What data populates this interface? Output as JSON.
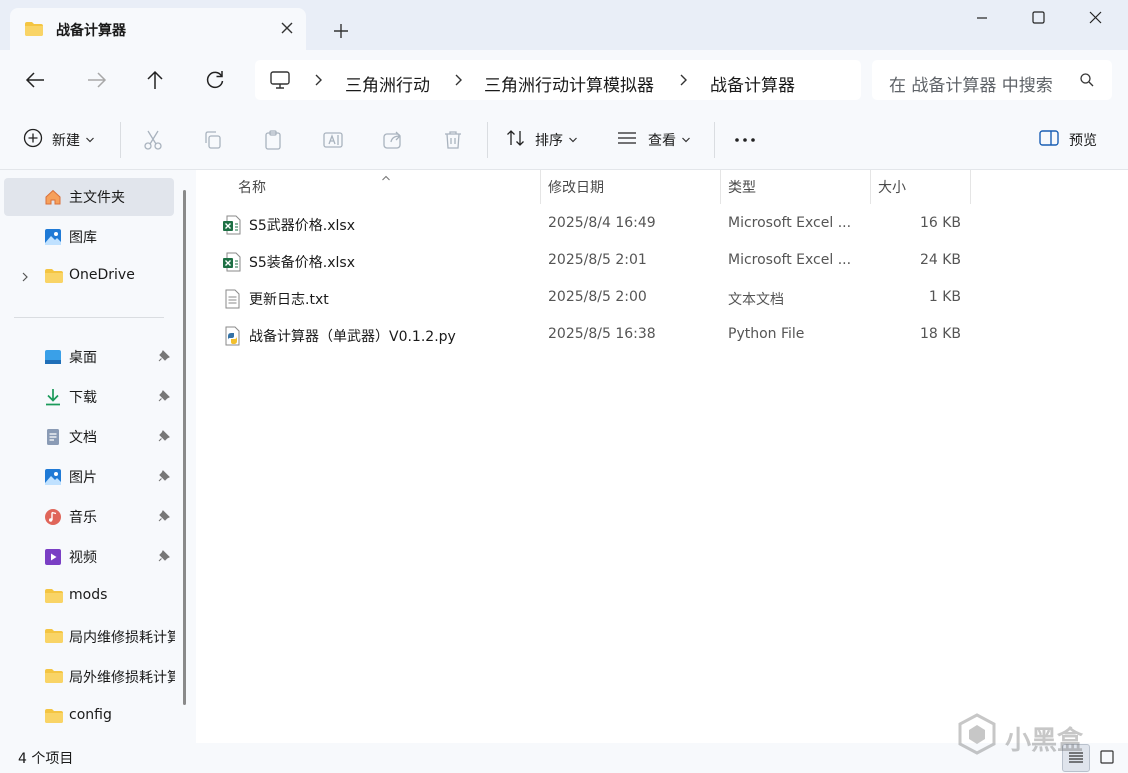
{
  "window": {
    "tab_title": "战备计算器"
  },
  "address": {
    "crumbs": [
      "三角洲行动",
      "三角洲行动计算模拟器",
      "战备计算器"
    ],
    "search_placeholder": "在 战备计算器 中搜索"
  },
  "toolbar": {
    "new_label": "新建",
    "sort_label": "排序",
    "view_label": "查看",
    "preview_label": "预览"
  },
  "sidebar": {
    "items": [
      {
        "label": "主文件夹",
        "icon": "home-icon"
      },
      {
        "label": "图库",
        "icon": "gallery-icon"
      },
      {
        "label": "OneDrive",
        "icon": "folder-icon"
      },
      {
        "label": "桌面",
        "icon": "desktop-icon"
      },
      {
        "label": "下载",
        "icon": "download-icon"
      },
      {
        "label": "文档",
        "icon": "document-icon"
      },
      {
        "label": "图片",
        "icon": "pictures-icon"
      },
      {
        "label": "音乐",
        "icon": "music-icon"
      },
      {
        "label": "视频",
        "icon": "video-icon"
      },
      {
        "label": "mods",
        "icon": "folder-icon"
      },
      {
        "label": "局内维修损耗计算器",
        "icon": "folder-icon"
      },
      {
        "label": "局外维修损耗计算器",
        "icon": "folder-icon"
      },
      {
        "label": "config",
        "icon": "folder-icon"
      }
    ]
  },
  "columns": {
    "name": "名称",
    "date": "修改日期",
    "type": "类型",
    "size": "大小"
  },
  "files": [
    {
      "name": "S5武器价格.xlsx",
      "date": "2025/8/4 16:49",
      "type": "Microsoft Excel ...",
      "size": "16 KB",
      "icon": "excel-icon"
    },
    {
      "name": "S5装备价格.xlsx",
      "date": "2025/8/5 2:01",
      "type": "Microsoft Excel ...",
      "size": "24 KB",
      "icon": "excel-icon"
    },
    {
      "name": "更新日志.txt",
      "date": "2025/8/5 2:00",
      "type": "文本文档",
      "size": "1 KB",
      "icon": "text-file-icon"
    },
    {
      "name": "战备计算器（单武器）V0.1.2.py",
      "date": "2025/8/5 16:38",
      "type": "Python File",
      "size": "18 KB",
      "icon": "python-file-icon"
    }
  ],
  "status": {
    "item_count": "4 个项目"
  },
  "watermark": {
    "text": "小黑盒"
  },
  "colors": {
    "accent": "#0067c0",
    "chrome_bg": "#e9eef7",
    "pane_bg": "#f7f9fc",
    "folder": "#f4c542",
    "excel": "#1d7044"
  }
}
